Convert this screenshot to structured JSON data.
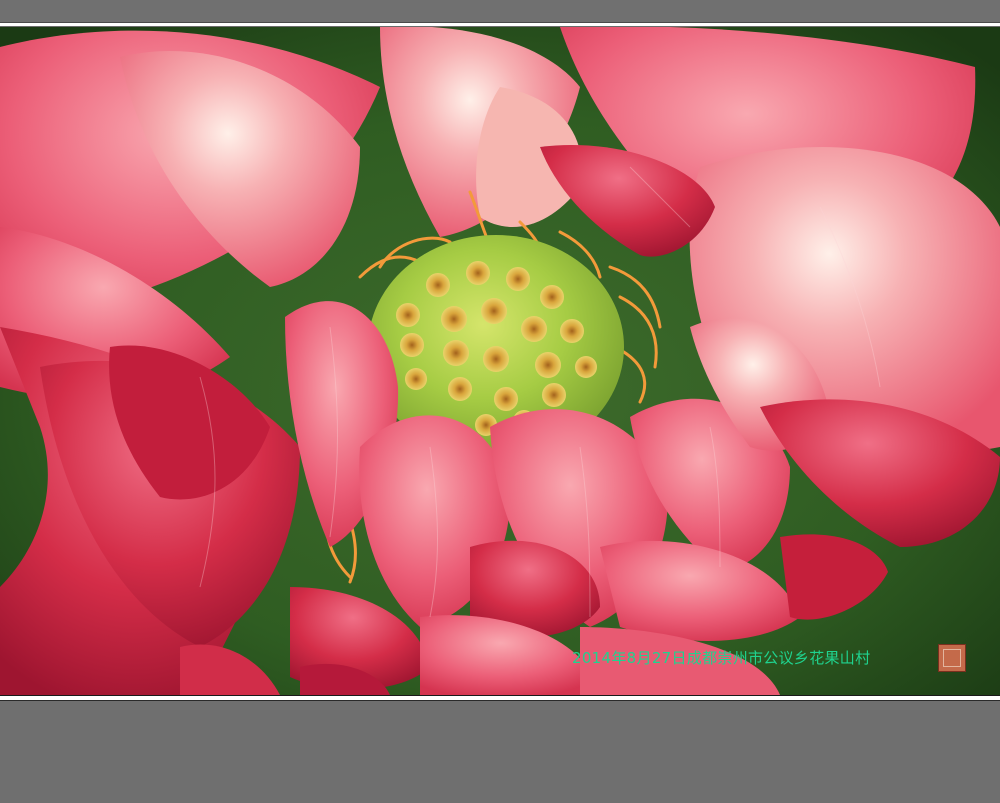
{
  "photo": {
    "subject": "lotus-flower",
    "caption": "2014年8月27日成都崇州市公议乡花果山村"
  },
  "colors": {
    "petal_light": "#f07a8c",
    "petal_deep": "#c7253f",
    "seedpod": "#9ccc3c",
    "stamen": "#f39a3a",
    "leaf": "#2f5d22",
    "caption": "#1fd38f",
    "frame_gray": "#6f6f6f"
  }
}
